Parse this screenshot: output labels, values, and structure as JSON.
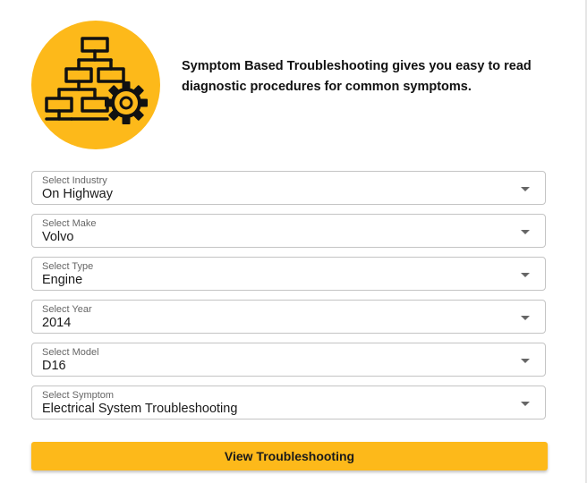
{
  "hero": {
    "icon": "flowchart-gear-icon",
    "accent_color": "#FDB91A",
    "description": "Symptom Based Troubleshooting gives you easy to read diagnostic procedures for common symptoms."
  },
  "form": {
    "industry": {
      "label": "Select Industry",
      "value": "On Highway"
    },
    "make": {
      "label": "Select Make",
      "value": "Volvo"
    },
    "type": {
      "label": "Select Type",
      "value": "Engine"
    },
    "year": {
      "label": "Select Year",
      "value": "2014"
    },
    "model": {
      "label": "Select Model",
      "value": "D16"
    },
    "symptom": {
      "label": "Select Symptom",
      "value": "Electrical System Troubleshooting"
    }
  },
  "actions": {
    "view_label": "View Troubleshooting",
    "button_color": "#FDB91A"
  }
}
